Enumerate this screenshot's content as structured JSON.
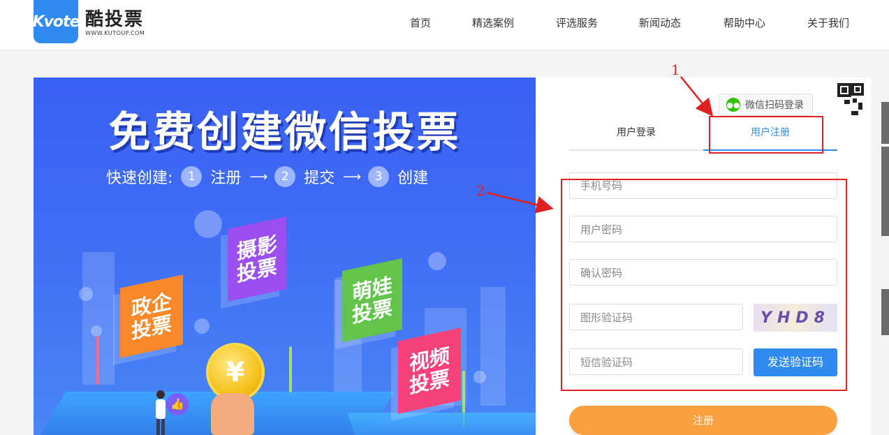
{
  "header": {
    "logo_text": "Kvote",
    "brand_name": "酷投票",
    "brand_url": "WWW.KUTOUP.COM",
    "nav": [
      "首页",
      "精选案例",
      "评选服务",
      "新闻动态",
      "帮助中心",
      "关于我们"
    ]
  },
  "banner": {
    "title": "免费创建微信投票",
    "steps_prefix": "快速创建:",
    "steps": [
      {
        "num": "1",
        "label": "注册"
      },
      {
        "num": "2",
        "label": "提交"
      },
      {
        "num": "3",
        "label": "创建"
      }
    ],
    "cards": [
      "政企\n投票",
      "摄影\n投票",
      "萌娃\n投票",
      "视频\n投票"
    ],
    "coin_symbol": "¥"
  },
  "form": {
    "wechat_login": "微信扫码登录",
    "tabs": {
      "login": "用户登录",
      "register": "用户注册"
    },
    "placeholders": {
      "phone": "手机号码",
      "password": "用户密码",
      "confirm": "确认密码",
      "captcha": "图形验证码",
      "sms": "短信验证码"
    },
    "captcha_text": "YHD8",
    "send_code": "发送验证码",
    "submit": "注册"
  },
  "annotations": {
    "one": "1",
    "two": "2"
  },
  "colors": {
    "accent": "#2f8bf0",
    "submit": "#fba03f",
    "annotation": "#e02020"
  }
}
